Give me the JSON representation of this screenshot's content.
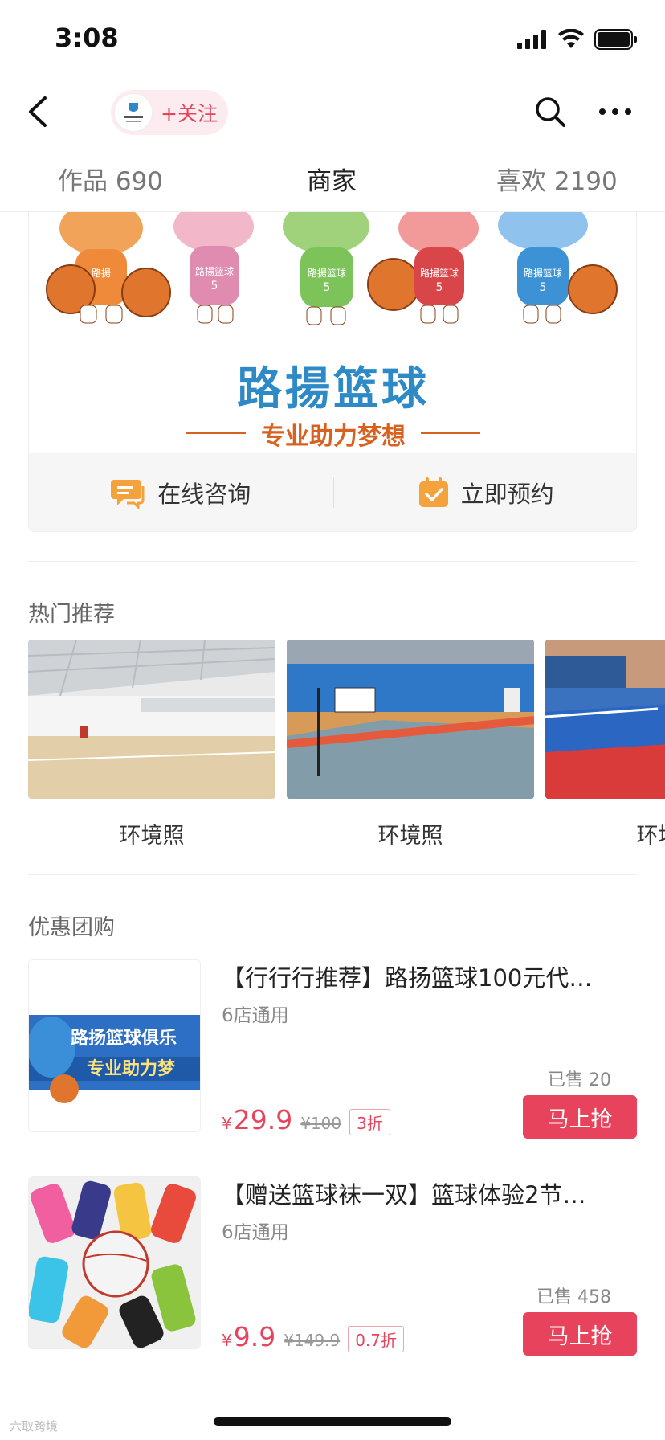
{
  "status_bar": {
    "time": "3:08"
  },
  "nav": {
    "follow_label": "+关注"
  },
  "tabs": [
    {
      "label": "作品 690"
    },
    {
      "label": "商家"
    },
    {
      "label": "喜欢 2190"
    }
  ],
  "banner": {
    "title": "路揚篮球",
    "slogan": "专业助力梦想",
    "actions": [
      {
        "label": "在线咨询",
        "icon": "chat-icon"
      },
      {
        "label": "立即预约",
        "icon": "calendar-check-icon"
      }
    ]
  },
  "hot": {
    "title": "热门推荐",
    "items": [
      {
        "label": "环境照"
      },
      {
        "label": "环境照"
      },
      {
        "label": "环境照"
      }
    ]
  },
  "deals": {
    "title": "优惠团购",
    "items": [
      {
        "title": "【行行行推荐】路扬篮球100元代…",
        "subtitle": "6店通用",
        "sold": "已售 20",
        "currency": "¥",
        "price": "29.9",
        "original_price": "¥100",
        "discount": "3折",
        "buy_label": "马上抢",
        "thumb_text_line1": "路扬篮球俱乐",
        "thumb_text_line2": "专业助力梦"
      },
      {
        "title": "【赠送篮球袜一双】篮球体验2节…",
        "subtitle": "6店通用",
        "sold": "已售 458",
        "currency": "¥",
        "price": "9.9",
        "original_price": "¥149.9",
        "discount": "0.7折",
        "buy_label": "马上抢"
      }
    ]
  },
  "watermark": "六取跨境",
  "colors": {
    "accent": "#e8435c",
    "brand_blue": "#2d8ac6",
    "slogan_orange": "#d9611f",
    "icon_orange": "#f3a23c"
  }
}
